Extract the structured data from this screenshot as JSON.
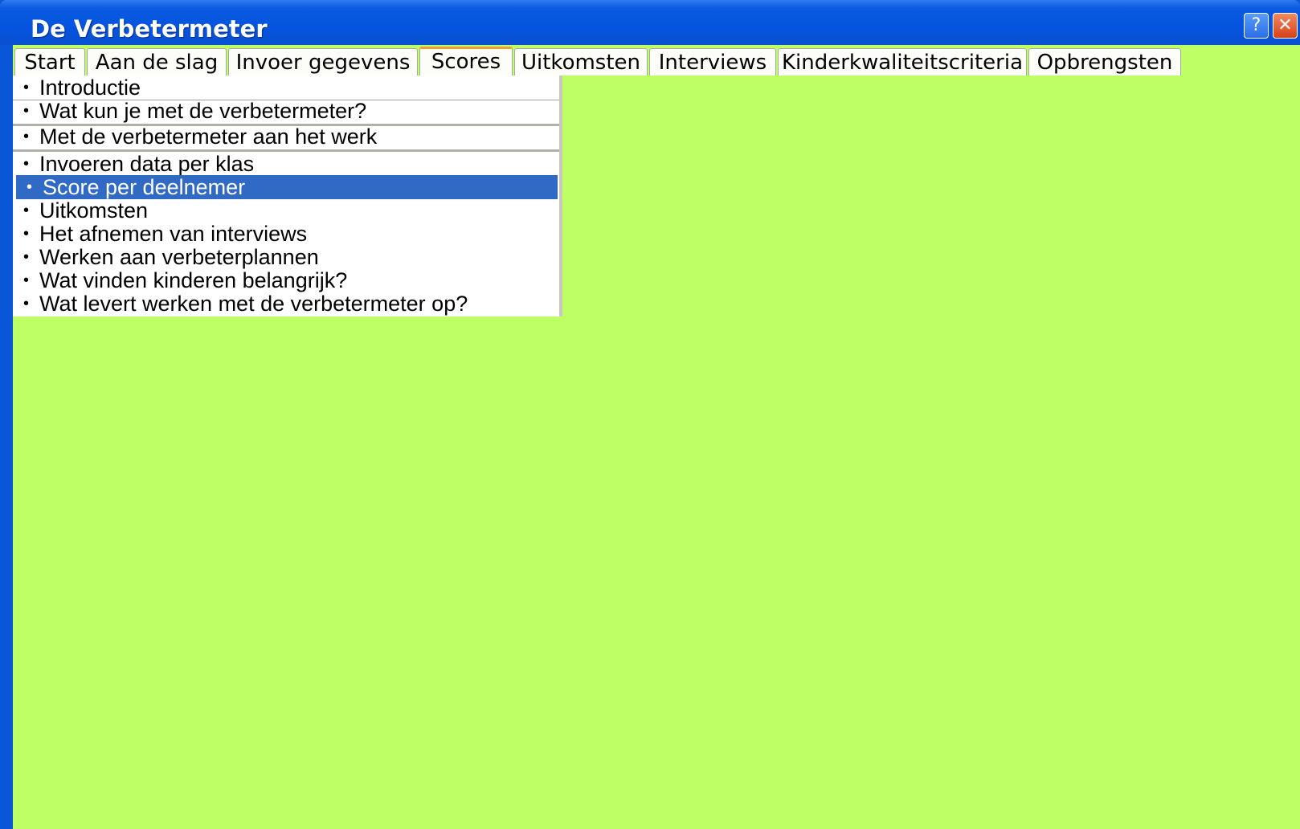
{
  "window": {
    "title": "De Verbetermeter",
    "help_glyph": "?",
    "close_glyph": "✕"
  },
  "tabs": [
    {
      "label": "Start",
      "active": false
    },
    {
      "label": "Aan de slag",
      "active": false
    },
    {
      "label": "Invoer gegevens",
      "active": false
    },
    {
      "label": "Scores",
      "active": true
    },
    {
      "label": "Uitkomsten",
      "active": false
    },
    {
      "label": "Interviews",
      "active": false
    },
    {
      "label": "Kinderkwaliteitscriteria",
      "active": false
    },
    {
      "label": "Opbrengsten",
      "active": false
    }
  ],
  "menu": {
    "bullet": "•",
    "items": [
      {
        "label": "Introductie"
      },
      {
        "label": "Wat kun je met de verbetermeter?"
      },
      {
        "label": "Met de verbetermeter aan het werk"
      },
      {
        "label": "Invoeren data per klas"
      },
      {
        "label": "Score per deelnemer",
        "selected": true
      },
      {
        "label": "Uitkomsten"
      },
      {
        "label": "Het afnemen van interviews"
      },
      {
        "label": "Werken aan verbeterplannen"
      },
      {
        "label": "Wat vinden kinderen belangrijk?"
      },
      {
        "label": "Wat levert werken met de verbetermeter op?"
      }
    ]
  },
  "colors": {
    "titlebar": "#0554e0",
    "client_background": "#bfff66",
    "selection": "#316ac5",
    "active_tab_accent": "#f0a030"
  }
}
